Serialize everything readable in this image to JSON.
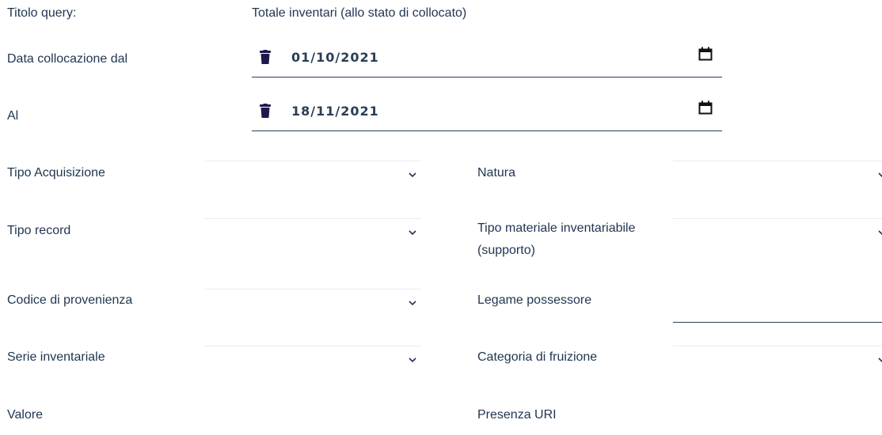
{
  "query": {
    "title_label": "Titolo query:",
    "title_value": "Totale inventari (allo stato di collocato)"
  },
  "dates": {
    "from_label": "Data collocazione dal",
    "from_value": "01/10/2021",
    "to_label": "Al",
    "to_value": "18/11/2021"
  },
  "fields": {
    "tipo_acquisizione": "Tipo Acquisizione",
    "natura": "Natura",
    "tipo_record": "Tipo record",
    "tipo_materiale": "Tipo materiale inventariabile (supporto)",
    "codice_provenienza": "Codice di provenienza",
    "legame_possessore": "Legame possessore",
    "serie_inventariale": "Serie inventariale",
    "categoria_fruizione": "Categoria di fruizione",
    "valore": "Valore",
    "presenza_uri": "Presenza URI"
  },
  "icons": {
    "trash": "trash-icon",
    "calendar": "calendar-icon",
    "chevron": "chevron-down-icon"
  },
  "colors": {
    "text": "#1f3550",
    "icon": "#1d1a4b",
    "underline": "#2c3e5a"
  }
}
